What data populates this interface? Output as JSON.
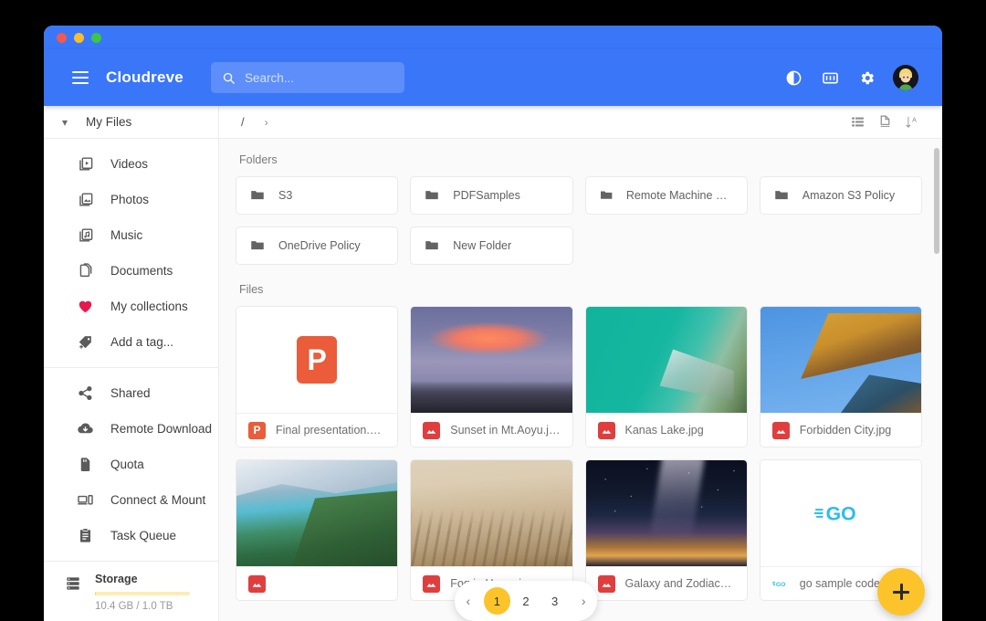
{
  "app": {
    "brand": "Cloudreve",
    "menu_icon": "hamburger-icon"
  },
  "search": {
    "placeholder": "Search...",
    "value": "",
    "icon": "search-icon"
  },
  "appbar_actions": [
    {
      "name": "dark-mode-icon",
      "label": "Toggle dark mode"
    },
    {
      "name": "vip-card-icon",
      "label": "Membership"
    },
    {
      "name": "gear-icon",
      "label": "Settings"
    }
  ],
  "avatar": {
    "name": "user-avatar",
    "label": "User profile"
  },
  "sidebar": {
    "header": {
      "label": "My Files",
      "chevron": "chevron-down-icon"
    },
    "groups": [
      {
        "items": [
          {
            "label": "Videos",
            "icon": "video-library-icon"
          },
          {
            "label": "Photos",
            "icon": "photo-library-icon"
          },
          {
            "label": "Music",
            "icon": "music-library-icon"
          },
          {
            "label": "Documents",
            "icon": "documents-icon"
          },
          {
            "label": "My collections",
            "icon": "heart-icon"
          },
          {
            "label": "Add a tag...",
            "icon": "tag-add-icon"
          }
        ]
      },
      {
        "items": [
          {
            "label": "Shared",
            "icon": "share-icon"
          },
          {
            "label": "Remote Download",
            "icon": "cloud-download-icon"
          },
          {
            "label": "Quota",
            "icon": "sd-card-icon"
          },
          {
            "label": "Connect & Mount",
            "icon": "devices-icon"
          },
          {
            "label": "Task Queue",
            "icon": "clipboard-list-icon"
          }
        ]
      }
    ],
    "storage": {
      "title": "Storage",
      "usage_text": "10.4 GB / 1.0 TB",
      "percent": 1,
      "bar_color": "#fcc947",
      "icon": "storage-icon"
    }
  },
  "toolbar": {
    "breadcrumb": [
      {
        "label": "/",
        "name": "breadcrumb-root"
      },
      {
        "label": "›",
        "name": "breadcrumb-chevron"
      }
    ],
    "actions": [
      {
        "name": "list-view-icon",
        "label": "List view"
      },
      {
        "name": "new-file-icon",
        "label": "New file"
      },
      {
        "name": "sort-az-icon",
        "label": "Sort"
      }
    ]
  },
  "content": {
    "folders_label": "Folders",
    "files_label": "Files",
    "folders": [
      {
        "name": "S3"
      },
      {
        "name": "PDFSamples"
      },
      {
        "name": "Remote Machine Poli..."
      },
      {
        "name": "Amazon S3 Policy"
      },
      {
        "name": "OneDrive Policy"
      },
      {
        "name": "New Folder"
      }
    ],
    "files": [
      {
        "name": "Final presentation.pp...",
        "badge": "ppt",
        "thumb": "ppt-placeholder"
      },
      {
        "name": "Sunset in Mt.Aoyu.jpg",
        "badge": "img",
        "thumb": "sunset"
      },
      {
        "name": "Kanas Lake.jpg",
        "badge": "img",
        "thumb": "kanas-harbor"
      },
      {
        "name": "Forbidden City.jpg",
        "badge": "img",
        "thumb": "forbidden-city"
      },
      {
        "name": "",
        "badge": "img",
        "thumb": "kanas-lake-mountain"
      },
      {
        "name": "Fog in Hemu.jpg",
        "badge": "img",
        "thumb": "fog-forest"
      },
      {
        "name": "Galaxy and Zodiacal ...",
        "badge": "img",
        "thumb": "galaxy"
      },
      {
        "name": "go sample code.go",
        "badge": "go",
        "thumb": "go-logo"
      }
    ]
  },
  "pagination": {
    "prev": "‹",
    "next": "›",
    "pages": [
      "1",
      "2",
      "3"
    ],
    "current": "1",
    "active_color": "#fcc42a"
  },
  "fab": {
    "label": "+",
    "name": "add-button",
    "color": "#fcc42a"
  },
  "colors": {
    "brand_blue": "#3a76f8",
    "accent_yellow": "#fcc42a",
    "heart_red": "#e8174d",
    "file_badge_red": "#e03e3e",
    "ppt_orange": "#ea5c3a",
    "go_blue": "#29beec"
  }
}
